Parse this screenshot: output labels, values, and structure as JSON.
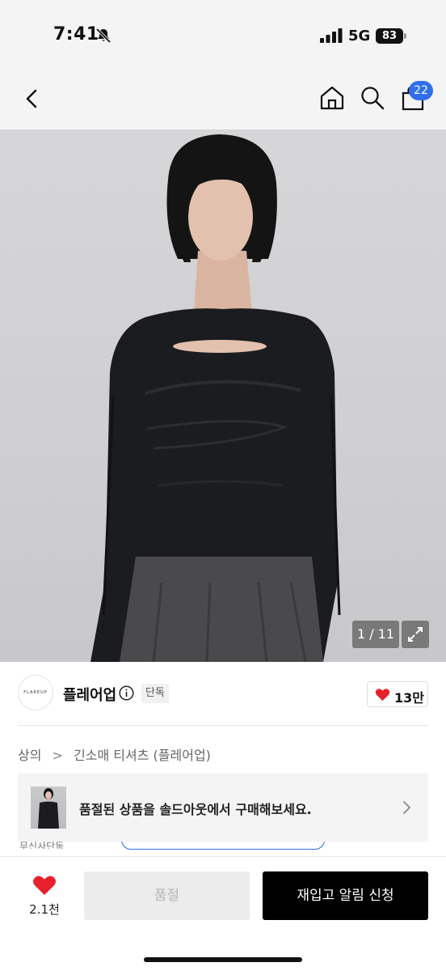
{
  "status_bar": {
    "time": "7:41",
    "network": "5G",
    "battery": "83"
  },
  "nav": {
    "cart_count": "22"
  },
  "gallery": {
    "counter": "1 / 11"
  },
  "brand": {
    "logo_text": "FLAREUP",
    "name": "플레어업",
    "exclusive_badge": "단독",
    "like_count": "13만"
  },
  "breadcrumb": {
    "category": "상의",
    "separator": ">",
    "subcategory": "긴소매 티셔츠 (플레어업)"
  },
  "banner": {
    "text": "품절된 상품을 솔드아웃에서 구매해보세요."
  },
  "peek": {
    "text": "무신사단독"
  },
  "bottom_bar": {
    "wish_count": "2.1천",
    "soldout_label": "품절",
    "restock_label": "재입고 알림 신청"
  },
  "colors": {
    "accent": "#2f6fed",
    "heart": "#e8202a",
    "primary_button": "#000000"
  }
}
